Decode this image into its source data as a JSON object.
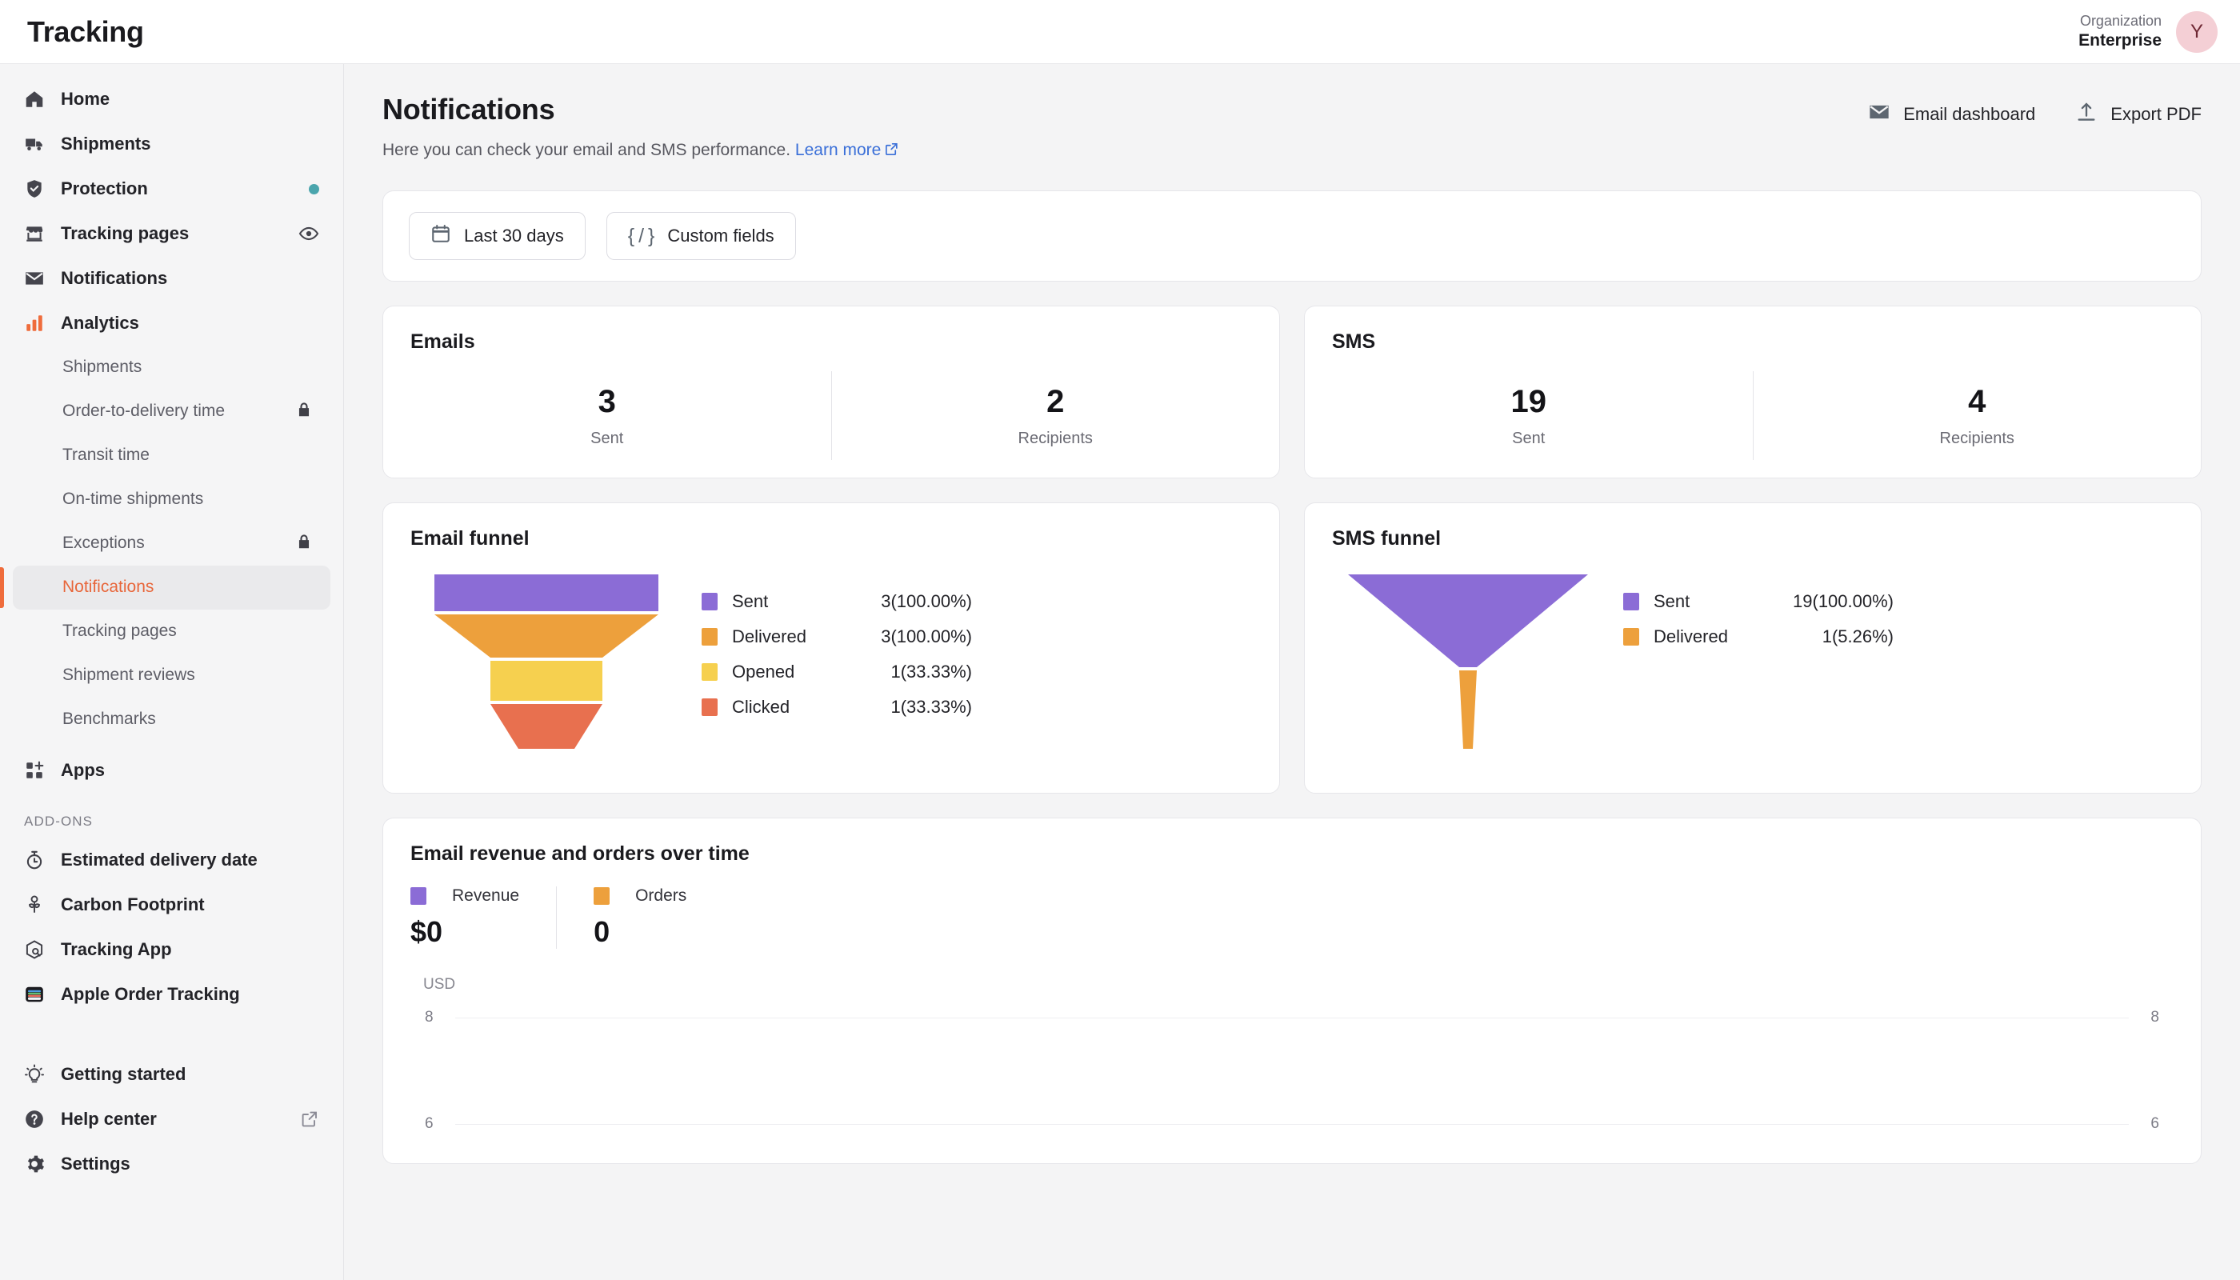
{
  "topbar": {
    "app_title": "Tracking",
    "org_label": "Organization",
    "org_name": "Enterprise",
    "avatar_initial": "Y"
  },
  "sidebar": {
    "primary": [
      {
        "label": "Home",
        "icon": "home-icon",
        "trailing": ""
      },
      {
        "label": "Shipments",
        "icon": "truck-icon",
        "trailing": ""
      },
      {
        "label": "Protection",
        "icon": "shield-check-icon",
        "trailing": "dot"
      },
      {
        "label": "Tracking pages",
        "icon": "storefront-icon",
        "trailing": "eye"
      },
      {
        "label": "Notifications",
        "icon": "envelope-icon",
        "trailing": ""
      },
      {
        "label": "Analytics",
        "icon": "bar-chart-icon",
        "trailing": ""
      }
    ],
    "analytics_children": [
      {
        "label": "Shipments",
        "locked": false,
        "active": false
      },
      {
        "label": "Order-to-delivery time",
        "locked": true,
        "active": false
      },
      {
        "label": "Transit time",
        "locked": false,
        "active": false
      },
      {
        "label": "On-time shipments",
        "locked": false,
        "active": false
      },
      {
        "label": "Exceptions",
        "locked": true,
        "active": false
      },
      {
        "label": "Notifications",
        "locked": false,
        "active": true
      },
      {
        "label": "Tracking pages",
        "locked": false,
        "active": false
      },
      {
        "label": "Shipment reviews",
        "locked": false,
        "active": false
      },
      {
        "label": "Benchmarks",
        "locked": false,
        "active": false
      }
    ],
    "apps": {
      "label": "Apps",
      "icon": "grid-plus-icon"
    },
    "addons_label": "ADD-ONS",
    "addons": [
      {
        "label": "Estimated delivery date",
        "icon": "stopwatch-icon"
      },
      {
        "label": "Carbon Footprint",
        "icon": "plant-icon"
      },
      {
        "label": "Tracking App",
        "icon": "box-search-icon"
      },
      {
        "label": "Apple Order Tracking",
        "icon": "apple-wallet-icon"
      }
    ],
    "footer": [
      {
        "label": "Getting started",
        "icon": "lightbulb-icon",
        "trailing": ""
      },
      {
        "label": "Help center",
        "icon": "question-circle-icon",
        "trailing": "external"
      },
      {
        "label": "Settings",
        "icon": "gear-icon",
        "trailing": ""
      }
    ]
  },
  "page": {
    "title": "Notifications",
    "subtitle": "Here you can check your email and SMS performance.",
    "learn_more": "Learn more",
    "actions": [
      {
        "label": "Email dashboard",
        "icon": "envelope-icon"
      },
      {
        "label": "Export PDF",
        "icon": "upload-icon"
      }
    ]
  },
  "filters": [
    {
      "label": "Last 30 days",
      "icon": "calendar-icon"
    },
    {
      "label": "Custom fields",
      "icon": "curly-slash-icon"
    }
  ],
  "stat_cards": [
    {
      "title": "Emails",
      "stats": [
        {
          "value": "3",
          "label": "Sent"
        },
        {
          "value": "2",
          "label": "Recipients"
        }
      ]
    },
    {
      "title": "SMS",
      "stats": [
        {
          "value": "19",
          "label": "Sent"
        },
        {
          "value": "4",
          "label": "Recipients"
        }
      ]
    }
  ],
  "colors": {
    "purple": "#8b6cd6",
    "orange": "#eda03c",
    "yellow": "#f6d04f",
    "red": "#e8704f",
    "accent": "#ef6c3c",
    "link": "#3a6fd8",
    "teal_dot": "#4aa5ad"
  },
  "chart_data": [
    {
      "type": "funnel",
      "title": "Email funnel",
      "categories": [
        "Sent",
        "Delivered",
        "Opened",
        "Clicked"
      ],
      "values": [
        3,
        3,
        1,
        1
      ],
      "percents": [
        "100.00%",
        "100.00%",
        "33.33%",
        "33.33%"
      ],
      "labels": [
        "3(100.00%)",
        "3(100.00%)",
        "1(33.33%)",
        "1(33.33%)"
      ],
      "colors": [
        "#8b6cd6",
        "#eda03c",
        "#f6d04f",
        "#e8704f"
      ],
      "widths": [
        1.0,
        1.0,
        0.49,
        0.49
      ],
      "legend_position": "right"
    },
    {
      "type": "funnel",
      "title": "SMS funnel",
      "categories": [
        "Sent",
        "Delivered"
      ],
      "values": [
        19,
        1
      ],
      "percents": [
        "100.00%",
        "5.26%"
      ],
      "labels": [
        "19(100.00%)",
        "1(5.26%)"
      ],
      "colors": [
        "#8b6cd6",
        "#eda03c"
      ],
      "widths": [
        1.0,
        0.0526
      ],
      "legend_position": "right"
    },
    {
      "type": "line",
      "title": "Email revenue and orders over time",
      "unit": "USD",
      "series": [
        {
          "name": "Revenue",
          "total": "$0",
          "color": "#8b6cd6",
          "values": []
        },
        {
          "name": "Orders",
          "total": "0",
          "color": "#eda03c",
          "values": []
        }
      ],
      "y_ticks_left": [
        "8",
        "6"
      ],
      "y_ticks_right": [
        "8",
        "6"
      ],
      "grid": true,
      "xlabel": "",
      "ylabel": "USD"
    }
  ]
}
